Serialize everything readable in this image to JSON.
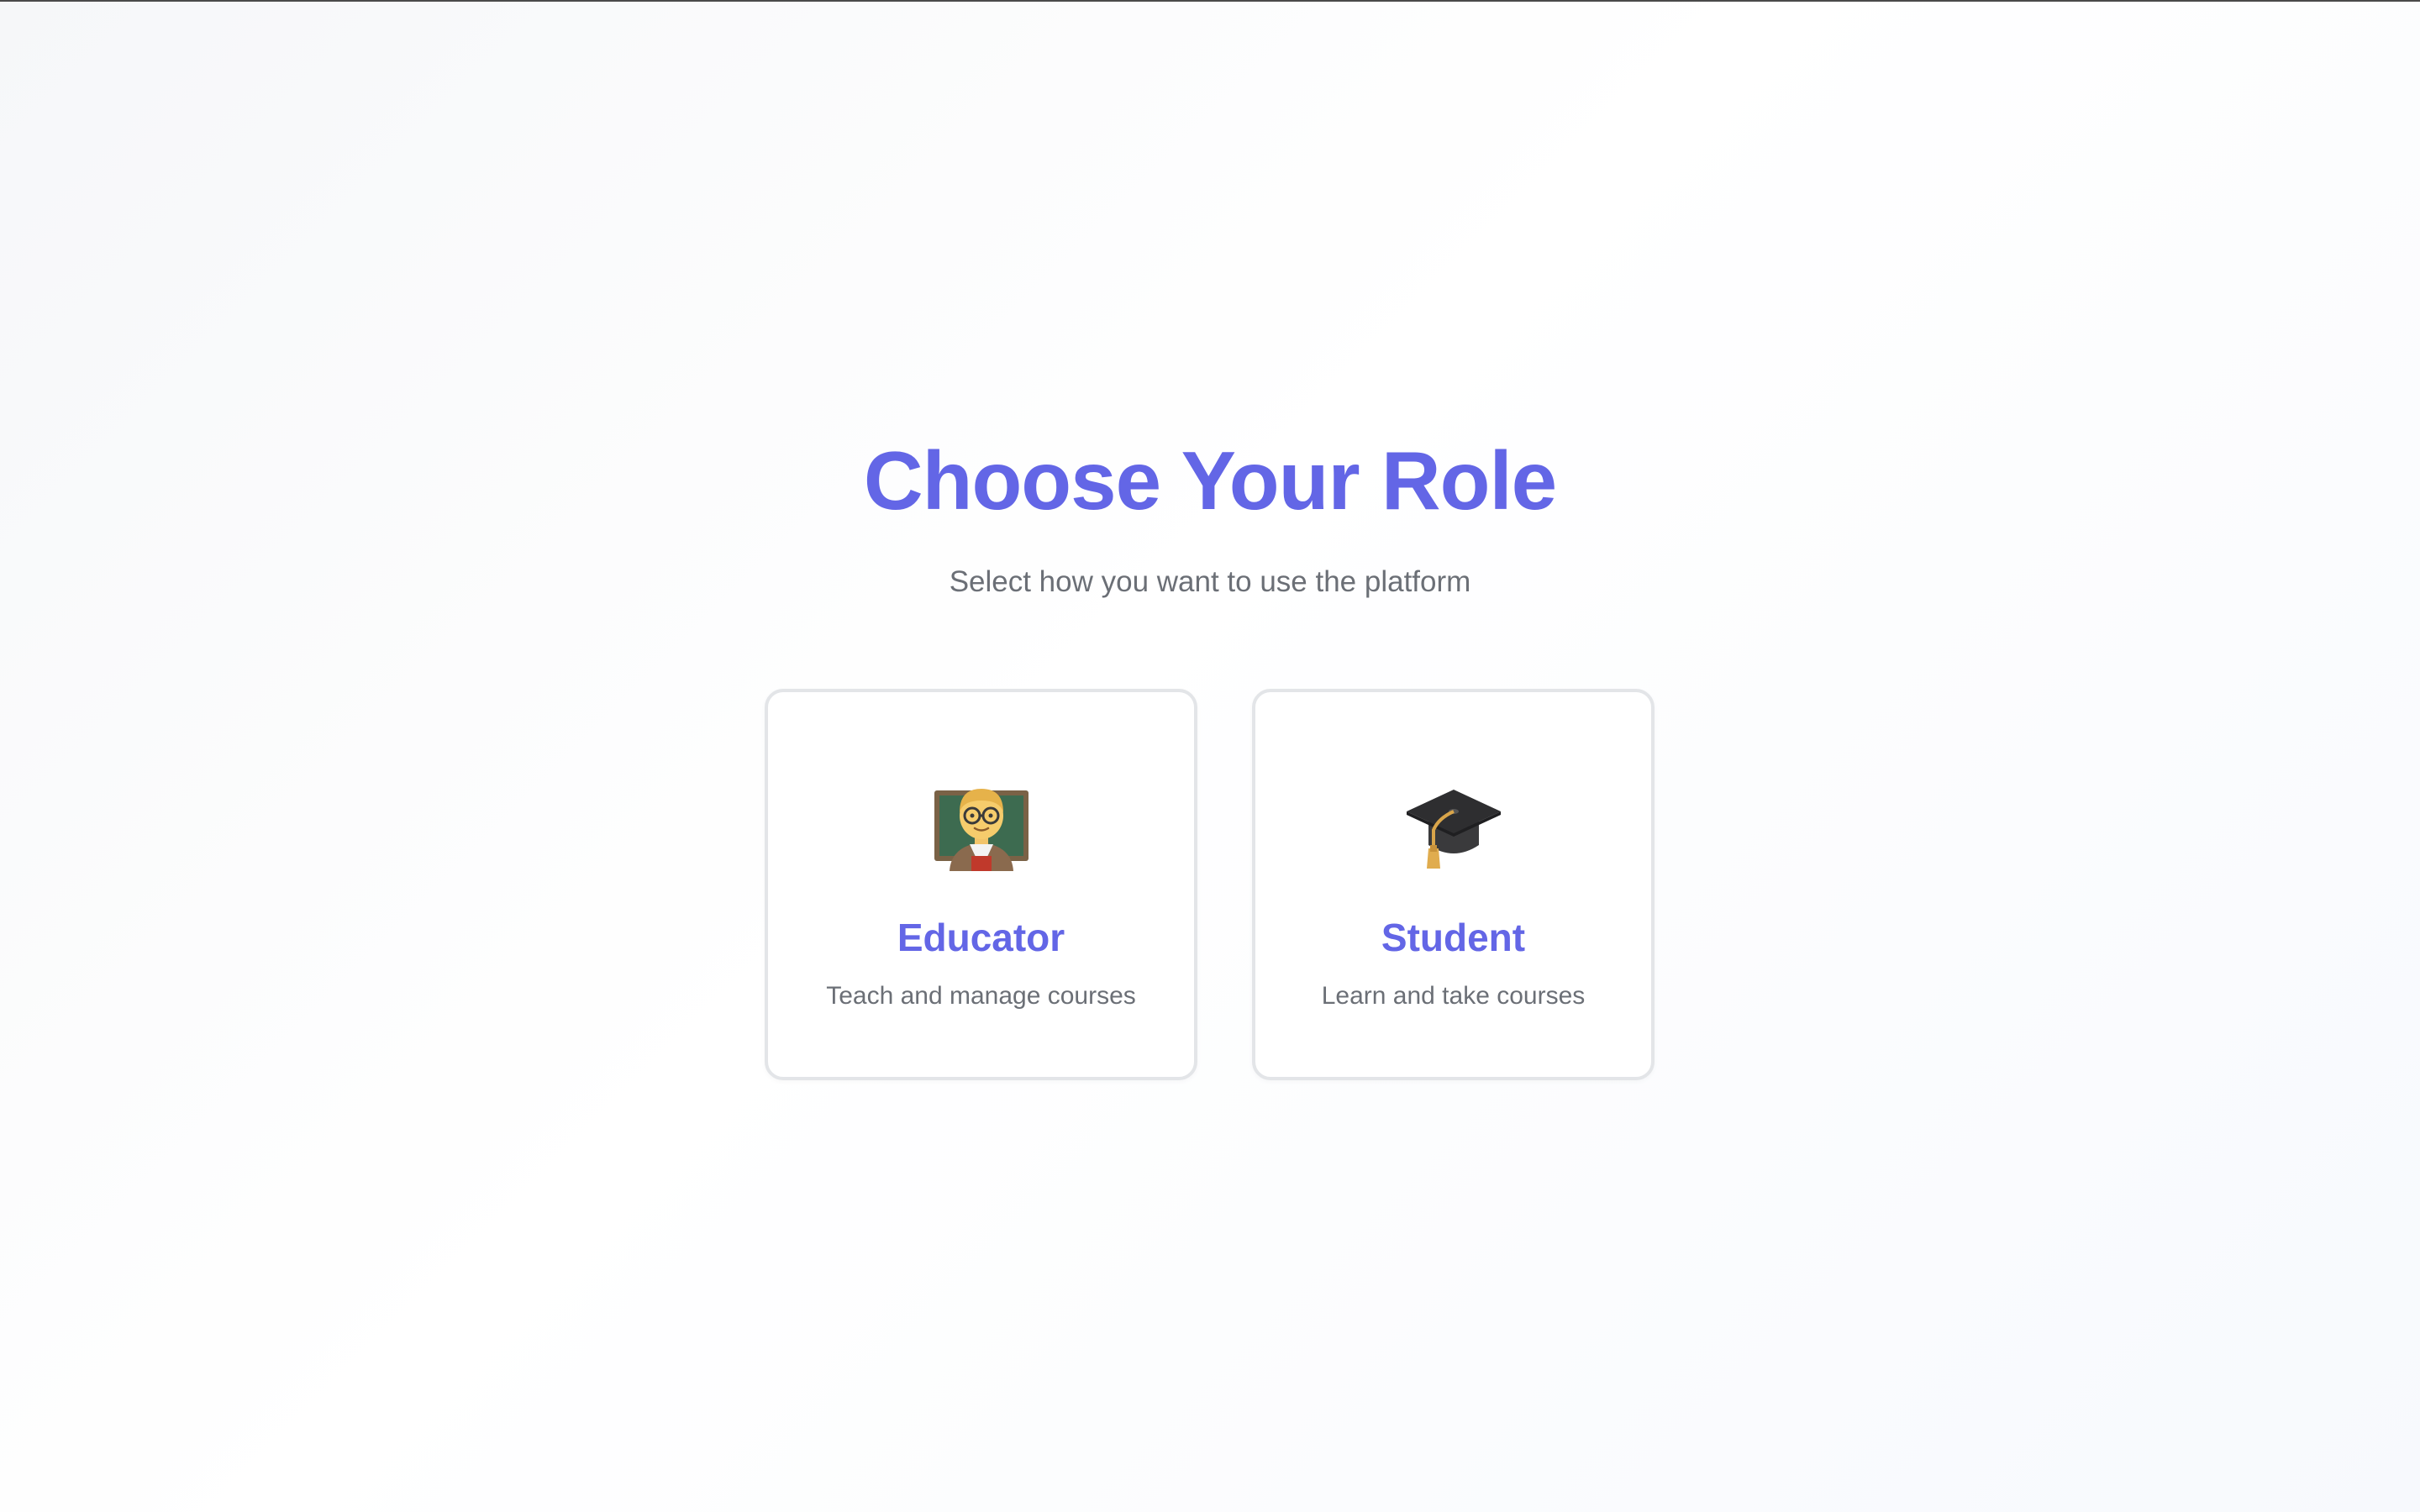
{
  "header": {
    "title": "Choose Your Role",
    "subtitle": "Select how you want to use the platform"
  },
  "roles": [
    {
      "label": "Educator",
      "description": "Teach and manage courses",
      "icon": "teacher-icon"
    },
    {
      "label": "Student",
      "description": "Learn and take courses",
      "icon": "graduation-cap-icon"
    }
  ],
  "colors": {
    "accent": "#6366e6",
    "muted_text": "#6b6f76",
    "card_border": "#e3e5e8"
  }
}
